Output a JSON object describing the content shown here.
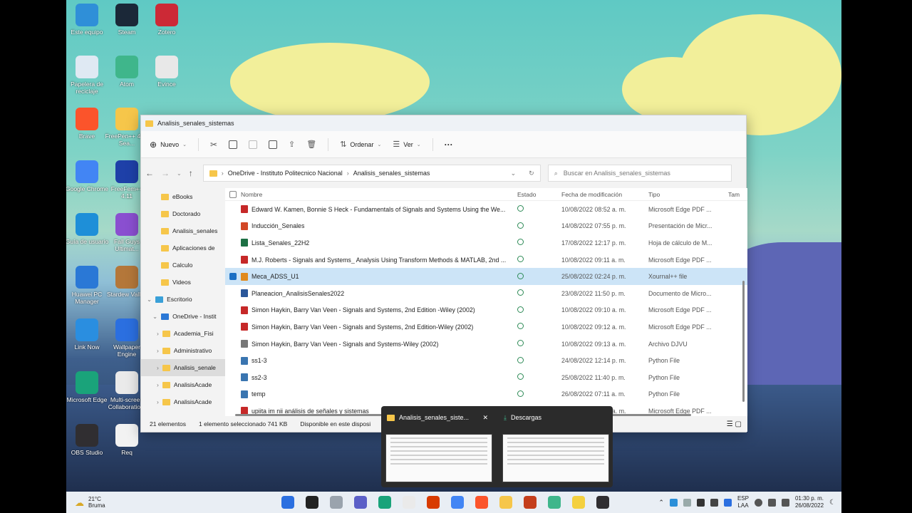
{
  "desktop": {
    "icons": [
      {
        "label": "Este equipo",
        "color": "#2f8fd8"
      },
      {
        "label": "Steam",
        "color": "#1b2838"
      },
      {
        "label": "Zotero",
        "color": "#cc2936"
      },
      {
        "label": "Papelera de reciclaje",
        "color": "#dfe9f3"
      },
      {
        "label": "Atom",
        "color": "#3fb68b"
      },
      {
        "label": "Evince",
        "color": "#e8e8e8"
      },
      {
        "label": "Brave",
        "color": "#fb542b"
      },
      {
        "label": "FreePen++ 4.11 Sea...",
        "color": "#f6c64a"
      },
      {
        "label": "Google Chrome",
        "color": "#4285f4"
      },
      {
        "label": "FreeFem++ 4.11",
        "color": "#1e40a8"
      },
      {
        "label": "Guía de usuario",
        "color": "#1e8fd8"
      },
      {
        "label": "Fall Guys Ultimat...",
        "color": "#8a4fd0"
      },
      {
        "label": "Huawei PC Manager",
        "color": "#2a78d6"
      },
      {
        "label": "Stardew Valley",
        "color": "#b4773a"
      },
      {
        "label": "Link Now",
        "color": "#2a8ee0"
      },
      {
        "label": "Wallpaper Engine",
        "color": "#2b6fe0"
      },
      {
        "label": "Microsoft Edge",
        "color": "#1aa37a"
      },
      {
        "label": "Multi-screen Collaboratio...",
        "color": "#eaeaea"
      },
      {
        "label": "OBS Studio",
        "color": "#302e31"
      },
      {
        "label": "Req",
        "color": "#f2f2f2"
      }
    ]
  },
  "explorer": {
    "title": "Analisis_senales_sistemas",
    "toolbar": {
      "new": "Nuevo",
      "sort": "Ordenar",
      "view": "Ver",
      "more": "···"
    },
    "address": {
      "root": "OneDrive - Instituto Politecnico Nacional",
      "current": "Analisis_senales_sistemas"
    },
    "search_placeholder": "Buscar en Analisis_senales_sistemas",
    "nav": [
      {
        "label": "eBooks",
        "indent": 0,
        "selected": false
      },
      {
        "label": "Doctorado",
        "indent": 0,
        "selected": false
      },
      {
        "label": "Analisis_senales",
        "indent": 0,
        "selected": false
      },
      {
        "label": "Aplicaciones de",
        "indent": 0,
        "selected": false
      },
      {
        "label": "Calculo",
        "indent": 0,
        "selected": false
      },
      {
        "label": "Videos",
        "indent": 0,
        "selected": false
      },
      {
        "label": "Escritorio",
        "indent": 1,
        "selected": false
      },
      {
        "label": "OneDrive - Instit",
        "indent": 2,
        "selected": false
      },
      {
        "label": "Academia_Fisi",
        "indent": 3,
        "selected": false
      },
      {
        "label": "Administrativo",
        "indent": 3,
        "selected": false
      },
      {
        "label": "Analisis_senale",
        "indent": 3,
        "selected": true
      },
      {
        "label": "AnalisisAcade",
        "indent": 3,
        "selected": false
      },
      {
        "label": "AnalisisAcade",
        "indent": 3,
        "selected": false
      }
    ],
    "columns": {
      "name": "Nombre",
      "state": "Estado",
      "date": "Fecha de modificación",
      "type": "Tipo",
      "size": "Tam"
    },
    "files": [
      {
        "name": "Edward W. Kamen, Bonnie S Heck - Fundamentals of Signals and Systems Using the We...",
        "date": "10/08/2022 08:52 a. m.",
        "type": "Microsoft Edge PDF ...",
        "icon": "#c62828",
        "selected": false
      },
      {
        "name": "Inducción_Senales",
        "date": "14/08/2022 07:55 p. m.",
        "type": "Presentación de Micr...",
        "icon": "#d24726",
        "selected": false
      },
      {
        "name": "Lista_Senales_22H2",
        "date": "17/08/2022 12:17 p. m.",
        "type": "Hoja de cálculo de M...",
        "icon": "#1d7044",
        "selected": false
      },
      {
        "name": "M.J. Roberts - Signals and Systems_ Analysis Using Transform Methods & MATLAB, 2nd ...",
        "date": "10/08/2022 09:11 a. m.",
        "type": "Microsoft Edge PDF ...",
        "icon": "#c62828",
        "selected": false
      },
      {
        "name": "Meca_ADSS_U1",
        "date": "25/08/2022 02:24 p. m.",
        "type": "Xournal++ file",
        "icon": "#e08a1e",
        "selected": true
      },
      {
        "name": "Planeacion_AnalisisSenales2022",
        "date": "23/08/2022 11:50 p. m.",
        "type": "Documento de Micro...",
        "icon": "#2b579a",
        "selected": false
      },
      {
        "name": "Simon Haykin, Barry Van Veen - Signals and Systems, 2nd Edition -Wiley (2002)",
        "date": "10/08/2022 09:10 a. m.",
        "type": "Microsoft Edge PDF ...",
        "icon": "#c62828",
        "selected": false
      },
      {
        "name": "Simon Haykin, Barry Van Veen - Signals and Systems, 2nd Edition-Wiley (2002)",
        "date": "10/08/2022 09:12 a. m.",
        "type": "Microsoft Edge PDF ...",
        "icon": "#c62828",
        "selected": false
      },
      {
        "name": "Simon Haykin, Barry Van Veen - Signals and Systems-Wiley (2002)",
        "date": "10/08/2022 09:13 a. m.",
        "type": "Archivo DJVU",
        "icon": "#777777",
        "selected": false
      },
      {
        "name": "ss1-3",
        "date": "24/08/2022 12:14 p. m.",
        "type": "Python File",
        "icon": "#3a75b0",
        "selected": false
      },
      {
        "name": "ss2-3",
        "date": "25/08/2022 11:40 p. m.",
        "type": "Python File",
        "icon": "#3a75b0",
        "selected": false
      },
      {
        "name": "temp",
        "date": "26/08/2022 07:11 a. m.",
        "type": "Python File",
        "icon": "#3a75b0",
        "selected": false
      },
      {
        "name": "upiita im nii análisis de señales y sistemas",
        "date": "10/08/2022 12:23 a. m.",
        "type": "Microsoft Edge PDF ...",
        "icon": "#c62828",
        "selected": false
      }
    ],
    "status": {
      "count": "21 elementos",
      "selection": "1 elemento seleccionado  741 KB",
      "availability": "Disponible en este disposi"
    }
  },
  "thumbnails": [
    {
      "title": "Analisis_senales_siste...",
      "close": "✕"
    },
    {
      "title": "Descargas",
      "close": ""
    }
  ],
  "taskbar": {
    "weather_temp": "21°C",
    "weather_desc": "Bruma",
    "apps": [
      "#2b6fe0",
      "#222222",
      "#9aa3ad",
      "#5b5fc7",
      "#1aa37a",
      "#eaeaea",
      "#d83b01",
      "#4285f4",
      "#fb542b",
      "#f6c64a",
      "#c43e1c",
      "#3fb68b",
      "#f4d03f",
      "#302e31"
    ],
    "lang_top": "ESP",
    "lang_bottom": "LAA",
    "time": "01:30 p. m.",
    "date": "26/08/2022"
  }
}
